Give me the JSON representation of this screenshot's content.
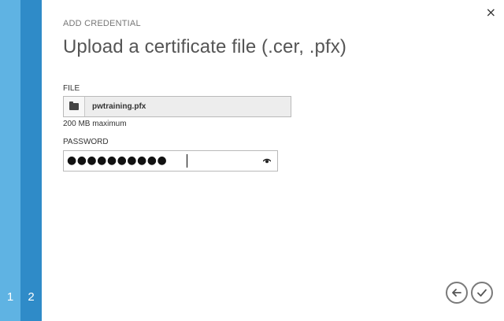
{
  "steps": [
    "1",
    "2"
  ],
  "header": {
    "kicker": "ADD CREDENTIAL",
    "title": "Upload a certificate file (.cer, .pfx)"
  },
  "file": {
    "label": "FILE",
    "value": "pwtraining.pfx",
    "hint": "200 MB maximum",
    "icon": "folder-icon"
  },
  "password": {
    "label": "PASSWORD",
    "masked_value": "●●●●●●●●●●",
    "icon": "eye-icon"
  },
  "icons": {
    "close": "×",
    "back": "arrow-left-icon",
    "confirm": "checkmark-icon"
  },
  "colors": {
    "rail_light": "#5fb3e3",
    "rail_dark": "#2f8bc8",
    "button_border": "#7a7a7a"
  }
}
